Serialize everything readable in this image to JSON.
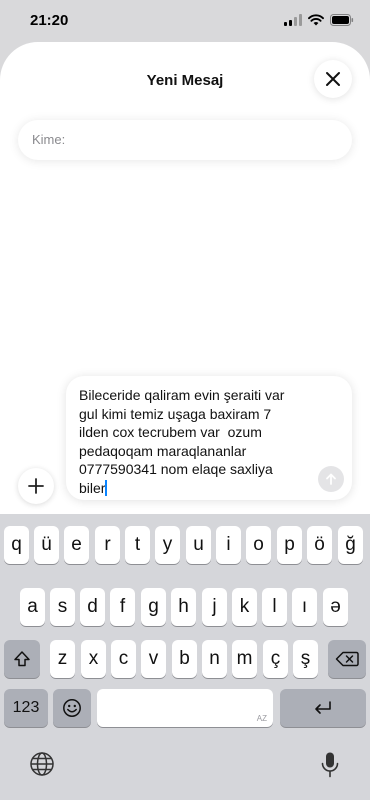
{
  "status_bar": {
    "time": "21:20"
  },
  "sheet": {
    "title": "Yeni Mesaj",
    "to_label": "Kime:"
  },
  "message": {
    "text": "Bileceride qaliram evin şeraiti var\ngul kimi temiz uşaga baxiram 7\nilden cox tecrubem var  ozum\npedaqoqam maraqlananlar\n0777590341 nom elaqe saxliya\nbiler"
  },
  "keyboard": {
    "row1": [
      "q",
      "ü",
      "e",
      "r",
      "t",
      "y",
      "u",
      "i",
      "o",
      "p",
      "ö",
      "ğ"
    ],
    "row2": [
      "a",
      "s",
      "d",
      "f",
      "g",
      "h",
      "j",
      "k",
      "l",
      "ı",
      "ə"
    ],
    "row3": [
      "z",
      "x",
      "c",
      "v",
      "b",
      "n",
      "m",
      "ç",
      "ş"
    ],
    "numbers_label": "123",
    "space_lang": "AZ"
  },
  "icons": [
    "signal-icon",
    "wifi-icon",
    "battery-icon",
    "close-icon",
    "plus-icon",
    "send-arrow-icon",
    "shift-icon",
    "backspace-icon",
    "emoji-icon",
    "return-icon",
    "globe-icon",
    "microphone-icon"
  ],
  "colors": {
    "accent": "#0a84ff",
    "keyboard_bg": "#d5d6da"
  }
}
